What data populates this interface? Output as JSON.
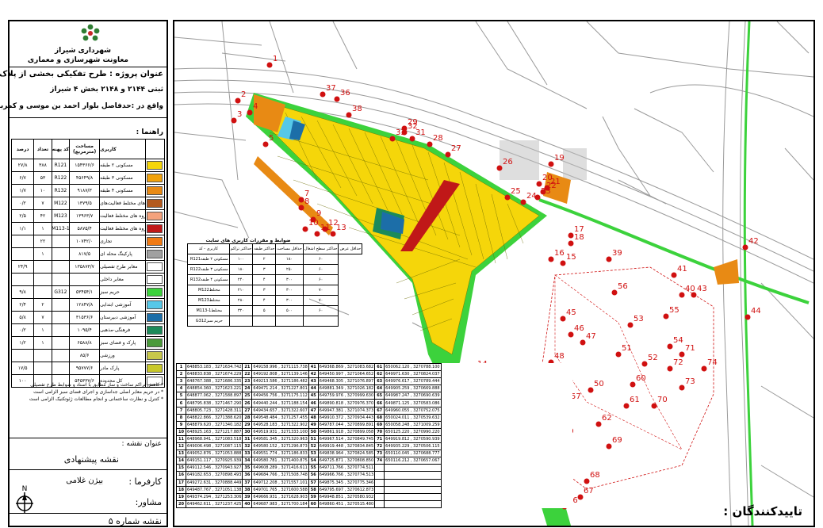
{
  "header": {
    "org": "شهرداری شیراز",
    "dept": "معاونت شهرسازی و معماری",
    "project_title": "عنوان پروژه : طرح تفکیکی بخشی از پلاک",
    "project_line2": "ثبتی ۲۱۴۴ و ۲۱۴۸ بخش ۴ شیراز",
    "project_line3": "واقع در :حدفاصل بلوار احمد بن موسی و کمربندی"
  },
  "legend": {
    "title": "راهنما :",
    "headers": {
      "use": "کاربری",
      "area": "مساحت (مترمربع)",
      "code": "کد پهنه",
      "count": "تعداد",
      "pct": "درصد"
    },
    "rows": [
      {
        "label": "مسکونی ۲ طبقه",
        "area": "۱۵۴۳۶۶/۶",
        "code": "R121",
        "count": "۳۸۸",
        "pct": "۲۷/۸",
        "color": "#f5d60a"
      },
      {
        "label": "مسکونی ۳ طبقه",
        "area": "۴۵۶۴۹/۸",
        "code": "R122",
        "count": "۵۳",
        "pct": "۶/۷",
        "color": "#f2a20a"
      },
      {
        "label": "مسکونی ۴ طبقه",
        "area": "۹۱۸۷/۳",
        "code": "R132",
        "count": "۱۰",
        "pct": "۱/۷",
        "color": "#e88a14"
      },
      {
        "label": "گروه های مختلط فعالیت‌های",
        "area": "۱۳۷۹/۵",
        "code": "M122",
        "count": "۷",
        "pct": "۰/۲",
        "color": "#b35a1e"
      },
      {
        "label": "گروه های مختلط فعالیت",
        "area": "۱۳۹۶۳/۷",
        "code": "M123",
        "count": "۴۲",
        "pct": "۲/۵",
        "color": "#f4a27c"
      },
      {
        "label": "گروه های مختلط فعالیت",
        "area": "۵۸۷۵/۴",
        "code": "M113-1",
        "count": "۱",
        "pct": "۱/۱",
        "color": "#c01818"
      },
      {
        "label": "تجاری",
        "area": "۱۰۷۴۲/۰",
        "code": "",
        "count": "۲۲",
        "pct": "",
        "color": "#f07a14"
      },
      {
        "label": "پارکینگ محله ای",
        "area": "۸۱۷/۵",
        "code": "",
        "count": "۱",
        "pct": "",
        "color": "#a0a0a0"
      },
      {
        "label": "معابر طرح تفصیلی",
        "area": "۱۳۵۸۷۳/۷",
        "code": "",
        "count": "",
        "pct": "۲۴/۹",
        "color": "#ffffff"
      },
      {
        "label": "معابر داخلی",
        "area": "",
        "code": "",
        "count": "",
        "pct": "",
        "color": "#ffffff"
      },
      {
        "label": "حریم سبز",
        "area": "۵۳۴۵۴/۱",
        "code": "G312",
        "count": "",
        "pct": "۹/۸",
        "color": "#3cd23c"
      },
      {
        "label": "آموزشی ابتدایی",
        "area": "۱۲۸۴۷/۸",
        "code": "",
        "count": "۲",
        "pct": "۲/۴",
        "color": "#56c8e8"
      },
      {
        "label": "آموزشی دبیرستان",
        "area": "۳۱۵۳۶/۶",
        "code": "",
        "count": "۷",
        "pct": "۵/۸",
        "color": "#1c6ea8"
      },
      {
        "label": "فرهنگی-مذهبی",
        "area": "۱۰۹۵/۴",
        "code": "",
        "count": "۱",
        "pct": "۰/۲",
        "color": "#1c8a5a"
      },
      {
        "label": "پارک و فضای سبز",
        "area": "۶۵۸۸/۸",
        "code": "",
        "count": "۱",
        "pct": "۱/۲",
        "color": "#4a9a3a"
      },
      {
        "label": "ورزشی",
        "area": "۸۵/۶",
        "code": "",
        "count": "",
        "pct": "",
        "color": "#c8c84a"
      },
      {
        "label": "پارک مادر",
        "area": "۹۵۷۷۷/۶",
        "code": "",
        "count": "",
        "pct": "۱۷/۵",
        "color": "#c8c82a"
      },
      {
        "label": "کل محدوده",
        "area": "۵۴۵۳۳۷/۶",
        "code": "",
        "count": "",
        "pct": "۱۰۰",
        "color": "#ffffff"
      }
    ]
  },
  "notes": [
    "* کاهش تراکم ساخت و ساز مطابق با اسناد و ضوابط طرح تفصیلی",
    "* در حریم معابر اصلی جداسازی و اجرای فضای سبز الزامی است",
    "* کنترل و نظارت ساختمانی و انجام مطالعات ژئوتکنیک الزامی است"
  ],
  "map_title_label": "عنوان نقشه :",
  "map_title_value": "نقشه پیشنهادی",
  "client_label": "کارفرما :",
  "client_value": "بیژن غلامی",
  "consultant_label": "مشاور:",
  "sheet_label": "نقشه شماره ۵",
  "north_label": "N",
  "approvers_label": "تاییدکنندگان :",
  "rules": {
    "title": "ضوابط و مقررات کاربری های سایت",
    "headers": [
      "کاربری - کد",
      "حداکثر تراکم",
      "حداکثر طبقه",
      "حداقل مساحت",
      "حداکثر سطح اشغال",
      "حداقل عرض"
    ],
    "rows": [
      [
        "مسکونی ۲ طبقه",
        "R121",
        "۱۰۰",
        "۲",
        "۱۸۰",
        "۶۰"
      ],
      [
        "مسکونی ۳ طبقه",
        "R122",
        "۱۸۰",
        "۳",
        "۲۵۰",
        "۶۰"
      ],
      [
        "مسکونی ۴ طبقه",
        "R132",
        "۲۴۰",
        "۴",
        "۳۰۰",
        "۶۰"
      ],
      [
        "مختلط",
        "M122",
        "۲۱۰",
        "۳",
        "۳۰۰",
        "۷۰"
      ],
      [
        "مختلط",
        "M123",
        "۲۸۰",
        "۴",
        "۳۰۰",
        "۷۰"
      ],
      [
        "مختلط",
        "M113-1",
        "۳۲۰",
        "۵",
        "۵۰۰",
        "۶۰"
      ],
      [
        "حریم سبز",
        "G312",
        "",
        "",
        "",
        ""
      ]
    ]
  },
  "coords": {
    "col1": [
      "648853.183 , 3271634.742",
      "648833.838 , 3271674.229",
      "648767.388 , 3271686.335",
      "648854.360 , 3271623.221",
      "648877.062 , 3271588.897",
      "648795.838 , 3271467.290",
      "648805.723 , 3271428.311",
      "648822.866 , 3271388.620",
      "648879.620 , 3271340.182",
      "648925.163 , 3271217.887",
      "648968.941 , 3271083.518",
      "649006.498 , 3271087.115",
      "649052.876 , 3271053.888",
      "649151.117 , 3270925.939",
      "649112.546 , 3270943.927",
      "649182.653 , 3270898.493",
      "649272.631 , 3270888.449",
      "649487.767 , 3271051.138",
      "649374.294 , 3271253.306",
      "649462.611 , 3271237.425"
    ],
    "col2": [
      "649158.996 , 3271115.738",
      "649192.808 , 3271139.146",
      "649213.586 , 3271186.482",
      "649471.214 , 3271227.801",
      "649456.756 , 3271175.112",
      "649440.244 , 3271188.154",
      "649434.657 , 3271322.607",
      "649548.484 , 3271257.455",
      "649528.183 , 3271322.902",
      "649519.931 , 3271333.100",
      "649581.345 , 3271320.963",
      "649580.152 , 3271296.873",
      "649551.774 , 3271186.833",
      "649580.781 , 3271400.875",
      "649608.289 , 3271416.611",
      "649684.766 , 3271508.748",
      "649712.208 , 3271557.101",
      "649701.765 , 3271600.588",
      "649666.931 , 3271628.903",
      "649687.983 , 3271700.184"
    ],
    "col3": [
      "649368.869 , 3271083.682",
      "649450.997 , 3271064.652",
      "649468.305 , 3271076.897",
      "649881.349 , 3271026.182",
      "649759.976 , 3270999.630",
      "649890.818 , 3270976.370",
      "649947.381 , 3271074.373",
      "649910.372 , 3270934.443",
      "649787.044 , 3270899.891",
      "649861.918 , 3270899.058",
      "649967.514 , 3270849.745",
      "649919.448 , 3270834.845",
      "649838.964 , 3270824.585",
      "649725.871 , 3270808.850",
      "649711.766 , 3270774.511",
      "649966.766 , 3270774.513",
      "649875.345 , 3270775.346",
      "649795.697 , 3270612.873",
      "649948.851 , 3270580.932",
      "649860.451 , 3270515.480"
    ],
    "col4": [
      "650062.120 , 3270788.100",
      "649971.630 , 3270824.037",
      "649976.617 , 3270789.444",
      "649905.259 , 3270669.888",
      "649987.247 , 3270690.639",
      "649871.125 , 3270583.086",
      "649960.055 , 3270752.075",
      "650024.011 , 3270539.632",
      "650058.248 , 3271009.259",
      "650125.220 , 3270990.220",
      "649919.812 , 3270590.939",
      "649935.229 , 3270506.115",
      "650110.045 , 3270688.777",
      "650116.212 , 3270657.067",
      "",
      "",
      "",
      "",
      "",
      ""
    ]
  },
  "point_labels": [
    {
      "n": "1"
    },
    {
      "n": "2"
    },
    {
      "n": "3"
    },
    {
      "n": "4"
    },
    {
      "n": "5"
    },
    {
      "n": "6"
    },
    {
      "n": "7"
    },
    {
      "n": "8"
    },
    {
      "n": "9"
    },
    {
      "n": "10"
    },
    {
      "n": "11"
    },
    {
      "n": "12"
    },
    {
      "n": "13"
    },
    {
      "n": "14"
    },
    {
      "n": "15"
    },
    {
      "n": "16"
    },
    {
      "n": "17"
    },
    {
      "n": "18"
    },
    {
      "n": "19"
    },
    {
      "n": "20"
    },
    {
      "n": "21"
    },
    {
      "n": "22"
    },
    {
      "n": "23"
    },
    {
      "n": "24"
    },
    {
      "n": "25"
    },
    {
      "n": "26"
    },
    {
      "n": "27"
    },
    {
      "n": "28"
    },
    {
      "n": "29"
    },
    {
      "n": "31"
    },
    {
      "n": "32"
    },
    {
      "n": "33"
    },
    {
      "n": "36"
    },
    {
      "n": "37"
    },
    {
      "n": "38"
    },
    {
      "n": "39"
    },
    {
      "n": "40"
    },
    {
      "n": "41"
    },
    {
      "n": "42"
    },
    {
      "n": "43"
    },
    {
      "n": "44"
    },
    {
      "n": "45"
    },
    {
      "n": "46"
    },
    {
      "n": "47"
    },
    {
      "n": "48"
    },
    {
      "n": "49"
    },
    {
      "n": "50"
    },
    {
      "n": "51"
    },
    {
      "n": "52"
    },
    {
      "n": "53"
    },
    {
      "n": "54"
    },
    {
      "n": "55"
    },
    {
      "n": "56"
    },
    {
      "n": "57"
    },
    {
      "n": "58"
    },
    {
      "n": "59"
    },
    {
      "n": "60"
    },
    {
      "n": "61"
    },
    {
      "n": "62"
    },
    {
      "n": "63"
    },
    {
      "n": "64"
    },
    {
      "n": "65"
    },
    {
      "n": "66"
    },
    {
      "n": "67"
    },
    {
      "n": "68"
    },
    {
      "n": "69"
    },
    {
      "n": "70"
    },
    {
      "n": "71"
    },
    {
      "n": "72"
    },
    {
      "n": "73"
    },
    {
      "n": "74"
    }
  ],
  "colors": {
    "green": "#3cd23c",
    "yellow": "#f5d60a",
    "orange": "#e88a14",
    "red": "#c01818",
    "blue": "#1c6ea8",
    "cyan": "#56c8e8",
    "road": "#9a9a9a"
  }
}
